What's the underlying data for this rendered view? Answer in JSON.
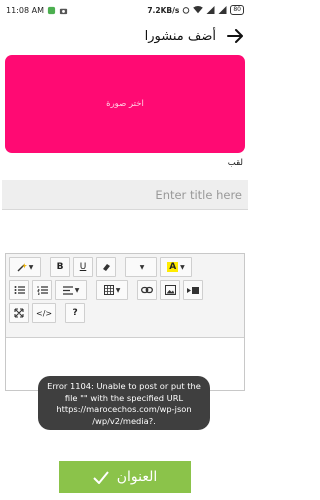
{
  "status_bar": {
    "time": "11:08 AM",
    "net_speed": "7.2KB/s",
    "battery": "80"
  },
  "app_bar": {
    "title": "أضف منشورا",
    "back_icon": "arrow-back-icon"
  },
  "image_picker": {
    "label": "اختر صورة",
    "color": "#ff0a73"
  },
  "title_field": {
    "label": "لقب",
    "placeholder": "Enter title here"
  },
  "editor_toolbar": {
    "rows": [
      [
        "magic-wand",
        "bold",
        "underline",
        "eraser",
        "font-size",
        "text-color"
      ],
      [
        "unordered-list",
        "ordered-list",
        "align",
        "table",
        "link",
        "picture",
        "video"
      ],
      [
        "fullscreen",
        "code-view",
        "help"
      ]
    ],
    "bold_label": "B",
    "underline_label": "U",
    "color_label": "A",
    "code_label": "</>",
    "help_label": "?"
  },
  "toast": {
    "message": "Error 1104: Unable to post or put the file \"\" with the specified URL https://marocechos.com/wp-json /wp/v2/media?."
  },
  "submit": {
    "label": "العنوان",
    "color": "#8bc34a"
  }
}
